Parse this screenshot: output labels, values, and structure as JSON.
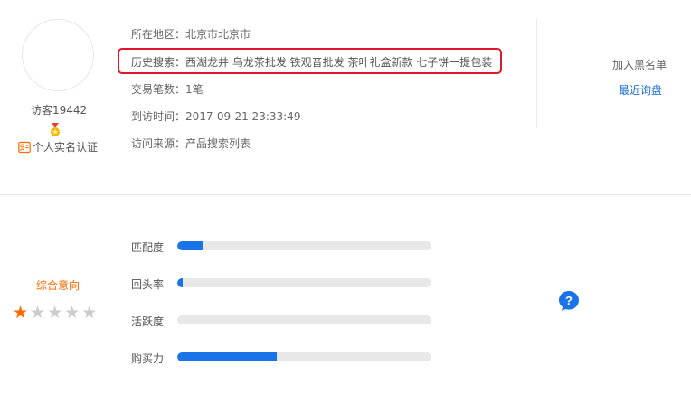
{
  "visitor": {
    "name": "访客19442",
    "verification": "个人实名认证"
  },
  "info": {
    "region": "所在地区：北京市北京市",
    "history": "历史搜索：西湖龙井 乌龙茶批发 铁观音批发 茶叶礼盒新款 七子饼一提包装",
    "deals": "交易笔数：1笔",
    "visit_time": "到访时间：2017-09-21 23:33:49",
    "source": "访问来源：产品搜索列表"
  },
  "actions": {
    "blacklist": "加入黑名单",
    "recent_inquiry": "最近询盘"
  },
  "intent": {
    "label": "综合意向",
    "rating": 1,
    "max_rating": 5
  },
  "metrics": [
    {
      "label": "匹配度",
      "value": 0.1
    },
    {
      "label": "回头率",
      "value": 0.02
    },
    {
      "label": "活跃度",
      "value": 0.0
    },
    {
      "label": "购买力",
      "value": 0.39
    }
  ],
  "colors": {
    "accent": "#1a73e8",
    "highlight_border": "#e0182b",
    "intent_orange": "#ff6a00",
    "star_on": "#ff6a00",
    "star_off": "#cccccc"
  },
  "icons": {
    "medal": "medal-icon",
    "id_card": "id-card-icon",
    "help": "help-icon"
  }
}
